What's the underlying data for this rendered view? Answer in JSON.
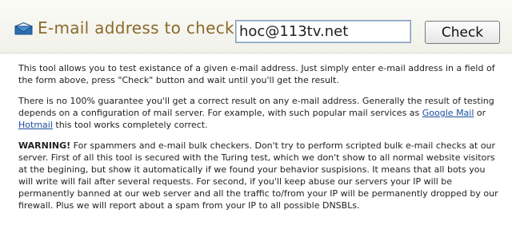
{
  "header": {
    "label": "E-mail address to check:",
    "input_value": "hoc@113tv.net",
    "check_button": "Check"
  },
  "intro": "This tool allows you to test existance of a given e-mail address. Just simply enter e-mail address in a field of the form above, press \"Check\" button and wait until you'll get the result.",
  "guarantee": {
    "before": "There is no 100% guarantee you'll get a correct result on any e-mail address. Generally the result of testing depends on a configuration of mail server. For example, with such popular mail services as ",
    "link_google": "Google Mail",
    "middle": " or ",
    "link_hotmail": "Hotmail",
    "after": " this tool works completely correct."
  },
  "warning": {
    "bold": "WARNING!",
    "text": " For spammers and e-mail bulk checkers. Don't try to perform scripted bulk e-mail checks at our server. First of all this tool is secured with the Turing test, which we don't show to all normal website visitors at the begining, but show it automatically if we found your behavior suspisions. It means that all bots you will write will fail after several requests. For second, if you'll keep abuse our servers your IP will be permanently banned at our web server and all the traffic to/from your IP will be permanently dropped by our firewall. Plus we will report about a spam from your IP to all possible DNSBLs."
  },
  "icons": {
    "envelope": "envelope-icon"
  },
  "colors": {
    "label": "#8a6a2a",
    "link": "#1a4fa0"
  }
}
